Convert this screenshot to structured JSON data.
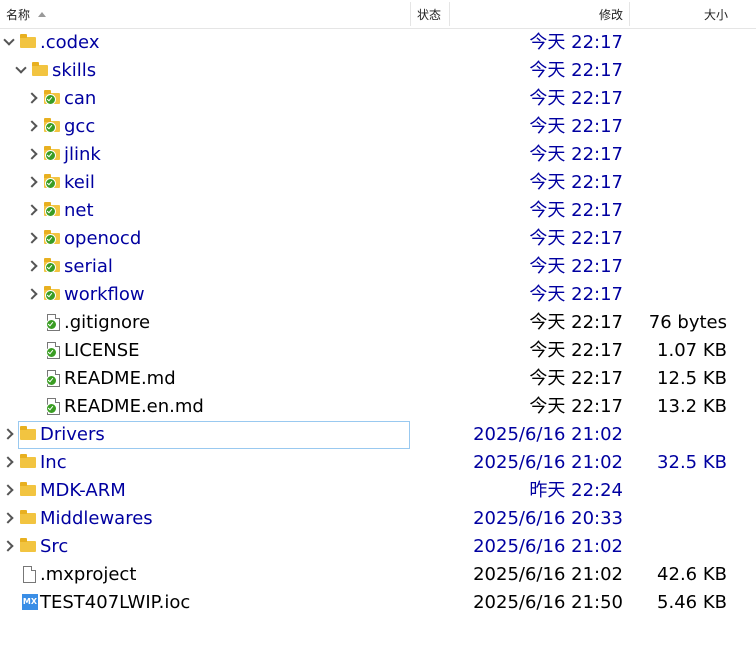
{
  "columns": {
    "name": "名称",
    "status": "状态",
    "modified": "修改",
    "size": "大小"
  },
  "rows": [
    {
      "name": ".codex",
      "date": "今天 22:17",
      "size": "",
      "kind": "folder",
      "level": 0,
      "expand": "down",
      "blue": true
    },
    {
      "name": "skills",
      "date": "今天 22:17",
      "size": "",
      "kind": "folder",
      "level": 1,
      "expand": "down",
      "blue": true
    },
    {
      "name": "can",
      "date": "今天 22:17",
      "size": "",
      "kind": "folder-ok",
      "level": 2,
      "expand": "right",
      "blue": true
    },
    {
      "name": "gcc",
      "date": "今天 22:17",
      "size": "",
      "kind": "folder-ok",
      "level": 2,
      "expand": "right",
      "blue": true
    },
    {
      "name": "jlink",
      "date": "今天 22:17",
      "size": "",
      "kind": "folder-ok",
      "level": 2,
      "expand": "right",
      "blue": true
    },
    {
      "name": "keil",
      "date": "今天 22:17",
      "size": "",
      "kind": "folder-ok",
      "level": 2,
      "expand": "right",
      "blue": true
    },
    {
      "name": "net",
      "date": "今天 22:17",
      "size": "",
      "kind": "folder-ok",
      "level": 2,
      "expand": "right",
      "blue": true
    },
    {
      "name": "openocd",
      "date": "今天 22:17",
      "size": "",
      "kind": "folder-ok",
      "level": 2,
      "expand": "right",
      "blue": true
    },
    {
      "name": "serial",
      "date": "今天 22:17",
      "size": "",
      "kind": "folder-ok",
      "level": 2,
      "expand": "right",
      "blue": true
    },
    {
      "name": "workflow",
      "date": "今天 22:17",
      "size": "",
      "kind": "folder-ok",
      "level": 2,
      "expand": "right",
      "blue": true
    },
    {
      "name": ".gitignore",
      "date": "今天 22:17",
      "size": "76 bytes",
      "kind": "file-ok",
      "level": 2,
      "expand": "",
      "blue": false
    },
    {
      "name": "LICENSE",
      "date": "今天 22:17",
      "size": "1.07 KB",
      "kind": "file-ok",
      "level": 2,
      "expand": "",
      "blue": false
    },
    {
      "name": "README.md",
      "date": "今天 22:17",
      "size": "12.5 KB",
      "kind": "md-ok",
      "level": 2,
      "expand": "",
      "blue": false
    },
    {
      "name": "README.en.md",
      "date": "今天 22:17",
      "size": "13.2 KB",
      "kind": "md-ok",
      "level": 2,
      "expand": "",
      "blue": false
    },
    {
      "name": "Drivers",
      "date": "2025/6/16 21:02",
      "size": "",
      "kind": "folder",
      "level": 0,
      "expand": "right",
      "blue": true,
      "selected": true
    },
    {
      "name": "Inc",
      "date": "2025/6/16 21:02",
      "size": "32.5 KB",
      "kind": "folder",
      "level": 0,
      "expand": "right",
      "blue": true
    },
    {
      "name": "MDK-ARM",
      "date": "昨天 22:24",
      "size": "",
      "kind": "folder",
      "level": 0,
      "expand": "right",
      "blue": true
    },
    {
      "name": "Middlewares",
      "date": "2025/6/16 20:33",
      "size": "",
      "kind": "folder",
      "level": 0,
      "expand": "right",
      "blue": true
    },
    {
      "name": "Src",
      "date": "2025/6/16 21:02",
      "size": "",
      "kind": "folder",
      "level": 0,
      "expand": "right",
      "blue": true
    },
    {
      "name": ".mxproject",
      "date": "2025/6/16 21:02",
      "size": "42.6 KB",
      "kind": "file",
      "level": 0,
      "expand": "",
      "blue": false
    },
    {
      "name": "TEST407LWIP.ioc",
      "date": "2025/6/16 21:50",
      "size": "5.46 KB",
      "kind": "mx",
      "level": 0,
      "expand": "",
      "blue": false
    }
  ],
  "icons": {
    "folder": "folder-icon",
    "file": "file-icon",
    "mx": "mx-file-icon",
    "ok": "check-badge-icon"
  },
  "colors": {
    "folder": "#f2c440",
    "link_text": "#0000a0",
    "badge": "#3a9d23",
    "selection": "#99c9f0"
  }
}
